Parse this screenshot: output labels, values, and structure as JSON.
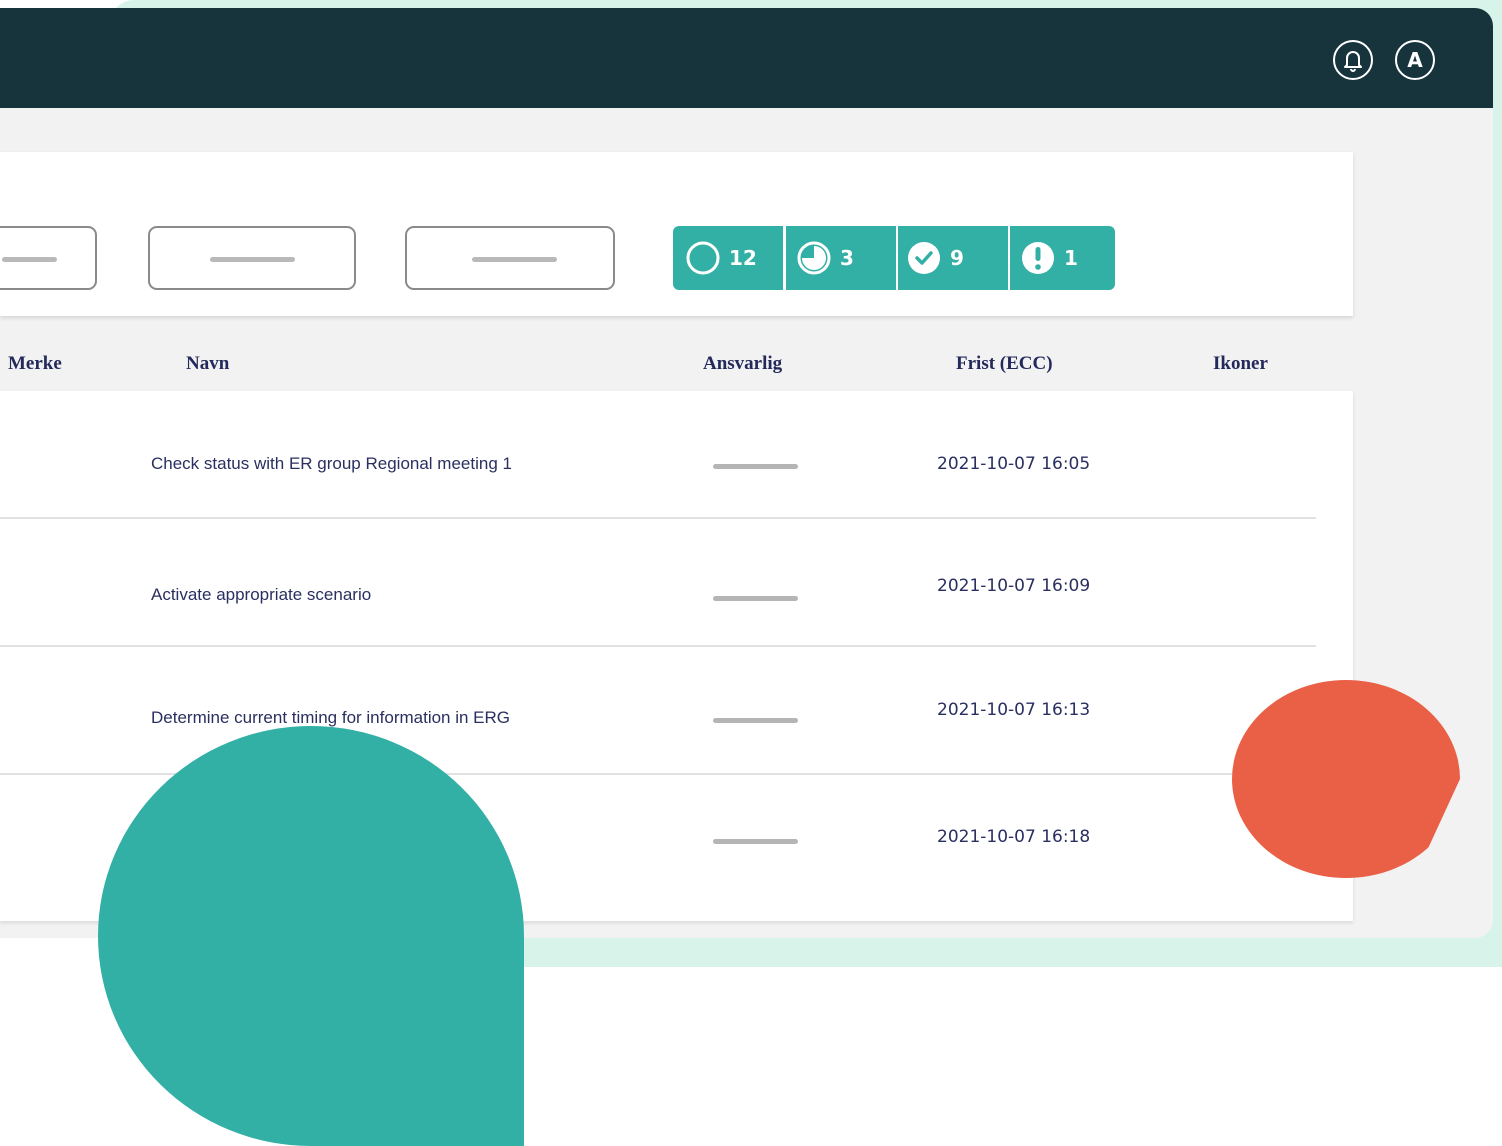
{
  "colors": {
    "topbar": "#17343c",
    "accent_teal": "#33b0a5",
    "accent_orange": "#ea6047",
    "mint_background": "#d8f3ea",
    "text_dark": "#23295a"
  },
  "header": {
    "icons": [
      "bell-icon",
      "avatar"
    ],
    "avatar_initial": "A"
  },
  "status_summary": [
    {
      "icon": "circle-open-icon",
      "count": "12"
    },
    {
      "icon": "pie-clock-icon",
      "count": "3"
    },
    {
      "icon": "check-circle-icon",
      "count": "9"
    },
    {
      "icon": "exclamation-icon",
      "count": "1"
    }
  ],
  "table": {
    "headers": {
      "merke": "Merke",
      "navn": "Navn",
      "ansvarlig": "Ansvarlig",
      "frist": "Frist (ECC)",
      "ikoner": "Ikoner"
    },
    "rows": [
      {
        "name": "Check status with ER group Regional meeting 1",
        "date": "2021-10-07 16:05"
      },
      {
        "name": "Activate appropriate scenario",
        "date": "2021-10-07 16:09"
      },
      {
        "name": "Determine current timing for information in ERG",
        "date": "2021-10-07 16:13"
      },
      {
        "name": "",
        "date": "2021-10-07 16:18"
      }
    ]
  }
}
